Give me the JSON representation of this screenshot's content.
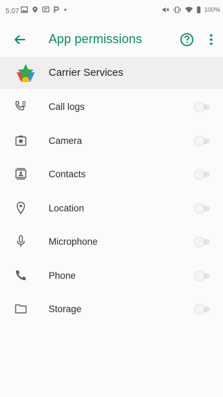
{
  "status_bar": {
    "time": "5:07",
    "battery": "100%",
    "left_icons": [
      "image-icon",
      "location-pin-icon",
      "message-icon",
      "p-icon",
      "dot-icon"
    ],
    "right_icons": [
      "mute-icon",
      "vibrate-icon",
      "wifi-icon",
      "battery-icon"
    ]
  },
  "app_bar": {
    "title": "App permissions",
    "back_icon": "arrow-back-icon",
    "help_icon": "help-icon",
    "overflow_icon": "more-vert-icon"
  },
  "app": {
    "name": "Carrier Services",
    "logo": "carrier-services-logo"
  },
  "permissions": [
    {
      "label": "Call logs",
      "icon": "call-log-icon",
      "enabled": false
    },
    {
      "label": "Camera",
      "icon": "camera-icon",
      "enabled": false
    },
    {
      "label": "Contacts",
      "icon": "contacts-icon",
      "enabled": false
    },
    {
      "label": "Location",
      "icon": "location-icon",
      "enabled": false
    },
    {
      "label": "Microphone",
      "icon": "microphone-icon",
      "enabled": false
    },
    {
      "label": "Phone",
      "icon": "phone-icon",
      "enabled": false
    },
    {
      "label": "Storage",
      "icon": "folder-icon",
      "enabled": false
    }
  ],
  "colors": {
    "accent": "#0e8a5f",
    "icon": "#5f6368",
    "background": "#fbfbfb",
    "header_bg": "#efefef"
  }
}
